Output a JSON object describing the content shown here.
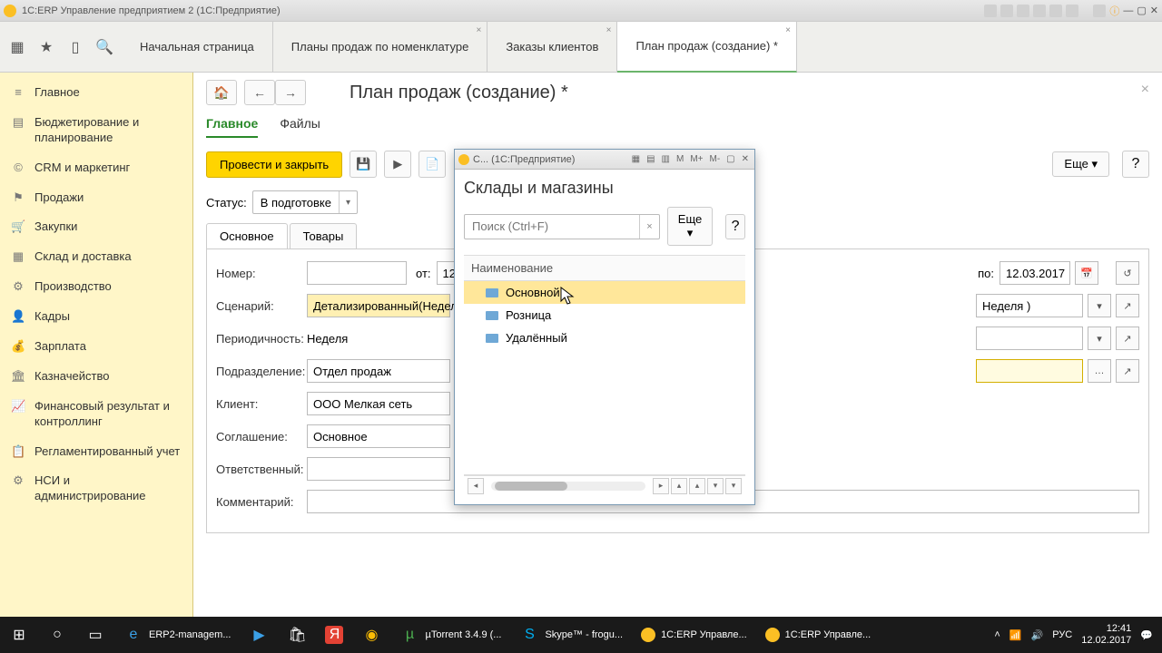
{
  "window": {
    "title": "1С:ERP Управление предприятием 2  (1С:Предприятие)"
  },
  "topTabs": {
    "t1": "Начальная страница",
    "t2": "Планы продаж по номенклатуре",
    "t3": "Заказы клиентов",
    "t4": "План продаж (создание) *"
  },
  "sidebar": {
    "items": [
      {
        "icon": "≡",
        "label": "Главное"
      },
      {
        "icon": "📊",
        "label": "Бюджетирование и планирование"
      },
      {
        "icon": "©",
        "label": "CRM и маркетинг"
      },
      {
        "icon": "🏷",
        "label": "Продажи"
      },
      {
        "icon": "🛒",
        "label": "Закупки"
      },
      {
        "icon": "🚚",
        "label": "Склад и доставка"
      },
      {
        "icon": "🔧",
        "label": "Производство"
      },
      {
        "icon": "👤",
        "label": "Кадры"
      },
      {
        "icon": "💰",
        "label": "Зарплата"
      },
      {
        "icon": "🏛",
        "label": "Казначейство"
      },
      {
        "icon": "📈",
        "label": "Финансовый результат и контроллинг"
      },
      {
        "icon": "📋",
        "label": "Регламентированный учет"
      },
      {
        "icon": "⚙",
        "label": "НСИ и администрирование"
      }
    ]
  },
  "page": {
    "title": "План продаж (создание) *",
    "subtabs": {
      "main": "Главное",
      "files": "Файлы"
    },
    "actions": {
      "submit": "Провести и закрыть",
      "more": "Еще",
      "help": "?"
    },
    "status": {
      "label": "Статус:",
      "value": "В подготовке"
    },
    "innerTabs": {
      "main": "Основное",
      "goods": "Товары"
    },
    "form": {
      "number_label": "Номер:",
      "from_label": "от:",
      "from_value": "12",
      "to_label": "по:",
      "to_value": "12.03.2017",
      "scenario_label": "Сценарий:",
      "scenario_value": "Детализированный(Недел",
      "scenario_right": "Неделя )",
      "period_label": "Периодичность:",
      "period_value": "Неделя",
      "dept_label": "Подразделение:",
      "dept_value": "Отдел продаж",
      "client_label": "Клиент:",
      "client_value": "ООО Мелкая сеть",
      "agreement_label": "Соглашение:",
      "agreement_value": "Основное",
      "responsible_label": "Ответственный:",
      "comment_label": "Комментарий:"
    }
  },
  "popup": {
    "winTitle": "С... (1С:Предприятие)",
    "title": "Склады и магазины",
    "search_placeholder": "Поиск (Ctrl+F)",
    "more": "Еще",
    "help": "?",
    "header": "Наименование",
    "rows": [
      {
        "label": "Основной",
        "sel": true
      },
      {
        "label": "Розница",
        "sel": false
      },
      {
        "label": "Удалённый",
        "sel": false
      }
    ],
    "mbuttons": {
      "m": "M",
      "mp": "M+",
      "mm": "M-"
    }
  },
  "taskbar": {
    "items": [
      {
        "icon": "⊞",
        "label": ""
      },
      {
        "icon": "○",
        "label": ""
      },
      {
        "icon": "📁",
        "label": ""
      },
      {
        "icon": "▭",
        "label": ""
      },
      {
        "icon": "e",
        "label": "ERP2-managem..."
      },
      {
        "icon": "▶",
        "label": ""
      },
      {
        "icon": "🛍",
        "label": ""
      },
      {
        "icon": "Я",
        "label": ""
      },
      {
        "icon": "◉",
        "label": ""
      },
      {
        "icon": "µ",
        "label": "µTorrent 3.4.9  (..."
      },
      {
        "icon": "S",
        "label": "Skype™ - frogu..."
      },
      {
        "icon": "1c",
        "label": "1С:ERP Управле..."
      },
      {
        "icon": "1c",
        "label": "1С:ERP Управле..."
      }
    ],
    "tray": {
      "lang": "РУС",
      "time": "12:41",
      "date": "12.02.2017"
    }
  }
}
